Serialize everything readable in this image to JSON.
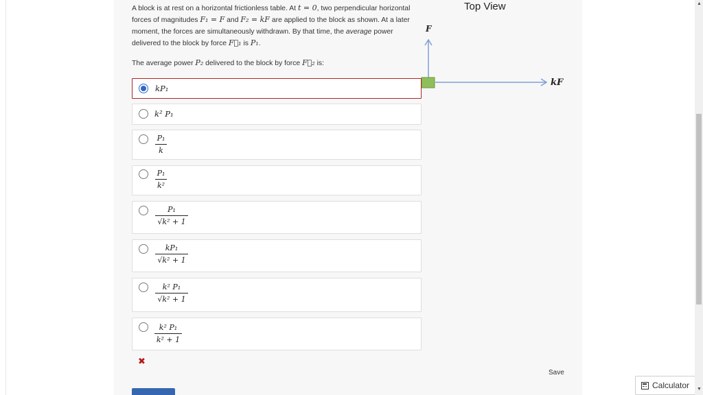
{
  "question": {
    "p1": "A block is at rest on a horizontal frictionless table. At",
    "t0": "t = 0",
    "p2": ", two perpendicular horizontal forces of magnitudes",
    "f1eq": "F₁ = F",
    "p3": "and",
    "f2eq": "F₂ = kF",
    "p4": "are applied to the block as shown. At a later moment, the forces are simultaneously withdrawn. By that time, the",
    "avg": "average",
    "p5": "power delivered to the block by force",
    "F1vec": "F⃗₁",
    "p6": "is",
    "P1": "P₁",
    "p7": "."
  },
  "subquestion": {
    "p1": "The average power",
    "P2": "P₂",
    "p2": "delivered to the block by force",
    "F2vec": "F⃗₂",
    "p3": "is:"
  },
  "diagram": {
    "title": "Top View",
    "label_up": "F",
    "label_right": "kF"
  },
  "options": [
    {
      "id": "a",
      "selected": true,
      "num": "kP₁"
    },
    {
      "id": "b",
      "selected": false,
      "num": "k² P₁"
    },
    {
      "id": "c",
      "selected": false,
      "num": "P₁",
      "den": "k"
    },
    {
      "id": "d",
      "selected": false,
      "num": "P₁",
      "den": "k²"
    },
    {
      "id": "e",
      "selected": false,
      "num": "P₁",
      "den": "√k² + 1"
    },
    {
      "id": "f",
      "selected": false,
      "num": "kP₁",
      "den": "√k² + 1"
    },
    {
      "id": "g",
      "selected": false,
      "num": "k² P₁",
      "den": "√k² + 1"
    },
    {
      "id": "h",
      "selected": false,
      "num": "k² P₁",
      "den": "k² + 1"
    }
  ],
  "feedback": {
    "incorrect_mark": "✖"
  },
  "save_label": "Save",
  "calculator_label": "Calculator",
  "colors": {
    "accent": "#2f66c7",
    "error": "#b02525",
    "block": "#8fbf5a",
    "arrow": "#7d9fd6"
  }
}
